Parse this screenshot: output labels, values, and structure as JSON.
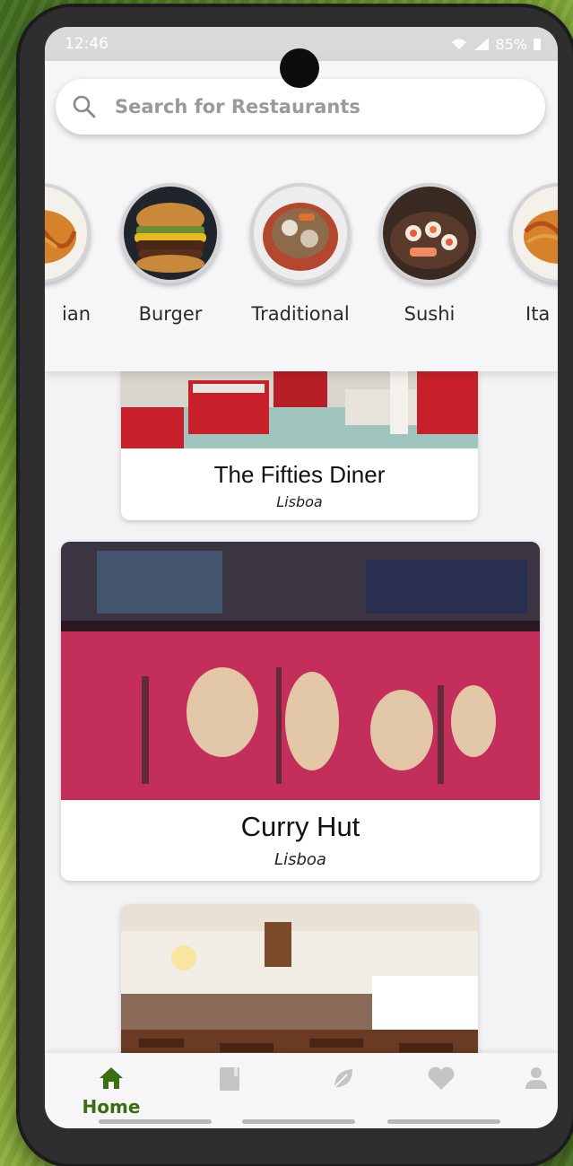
{
  "status_bar": {
    "time": "12:46",
    "battery": "85%"
  },
  "search": {
    "placeholder": "Search for Restaurants"
  },
  "categories": [
    {
      "label": "ian",
      "icon": "pasta-image"
    },
    {
      "label": "Burger",
      "icon": "burger-image"
    },
    {
      "label": "Traditional",
      "icon": "stew-pot-image"
    },
    {
      "label": "Sushi",
      "icon": "sushi-image"
    },
    {
      "label": "Ita",
      "icon": "pasta-image"
    }
  ],
  "restaurants": [
    {
      "name": "The Fifties Diner",
      "location": "Lisboa"
    },
    {
      "name": "Curry Hut",
      "location": "Lisboa"
    },
    {
      "name": "",
      "location": ""
    }
  ],
  "bottom_nav": {
    "active": "Home",
    "items": [
      {
        "label": "Home",
        "icon": "home-icon"
      },
      {
        "label": "",
        "icon": "book-icon"
      },
      {
        "label": "",
        "icon": "leaf-icon"
      },
      {
        "label": "",
        "icon": "heart-icon"
      },
      {
        "label": "",
        "icon": "user-icon"
      }
    ]
  },
  "colors": {
    "accent": "#3b6e12",
    "background": "#f3f3f5",
    "card": "#ffffff"
  }
}
